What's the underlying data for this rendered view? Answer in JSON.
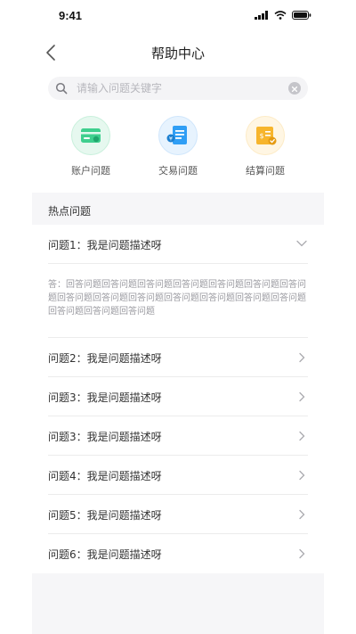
{
  "status_bar": {
    "time": "9:41"
  },
  "nav": {
    "title": "帮助中心"
  },
  "search": {
    "placeholder": "请输入问题关键字"
  },
  "categories": [
    {
      "label": "账户问题",
      "icon": "account-card-icon",
      "color": "#3ecf8e"
    },
    {
      "label": "交易问题",
      "icon": "transaction-scroll-icon",
      "color": "#2f9ef5"
    },
    {
      "label": "结算问题",
      "icon": "settlement-doc-icon",
      "color": "#f7b52c"
    }
  ],
  "hot": {
    "title": "热点问题",
    "expanded": {
      "question": "问题1：我是问题描述呀",
      "answer": "答：回答问题回答问题回答问题回答问题回答问题回答问题回答问题回答问题回答问题回答问题回答问题回答问题回答问题回答问题回答问题回答问题回答问题"
    },
    "questions": [
      "问题2：我是问题描述呀",
      "问题3：我是问题描述呀",
      "问题3：我是问题描述呀",
      "问题4：我是问题描述呀",
      "问题5：我是问题描述呀",
      "问题6：我是问题描述呀"
    ]
  }
}
